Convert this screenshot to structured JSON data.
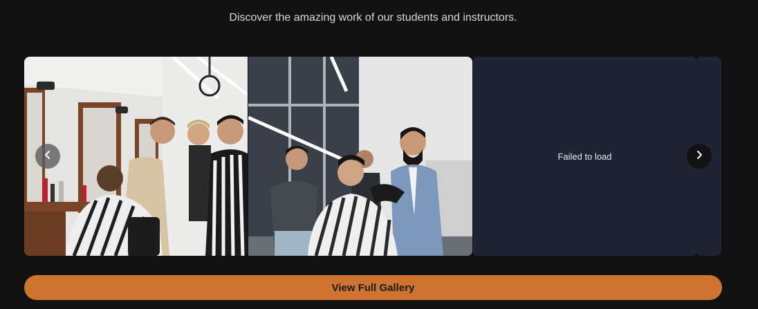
{
  "gallery": {
    "subtitle": "Discover the amazing work of our students and instructors.",
    "slides": [
      {
        "type": "photo",
        "subject": "barbershop-classroom"
      },
      {
        "type": "photo",
        "subject": "instructor-demonstration"
      },
      {
        "type": "error",
        "message": "Failed to load"
      },
      {
        "type": "error",
        "message": ""
      }
    ],
    "prev_icon": "chevron-left-icon",
    "next_icon": "chevron-right-icon",
    "cta_label": "View Full Gallery",
    "colors": {
      "background": "#121212",
      "accent": "#cf7430",
      "placeholder": "#1e2433",
      "subtitle": "#d9d9d9"
    }
  }
}
